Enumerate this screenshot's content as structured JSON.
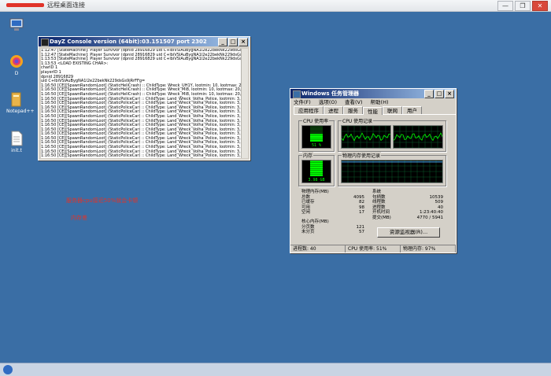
{
  "remote_title": "远程桌面连接",
  "remote_controls": {
    "minimize": "—",
    "restore": "❐",
    "close": "✕"
  },
  "desktop_icons": [
    {
      "label": "",
      "icon": "computer-icon"
    },
    {
      "label": "D",
      "icon": "media-player-icon"
    },
    {
      "label": "Notepad++",
      "icon": "folder-icon"
    },
    {
      "label": "init.t",
      "icon": "text-file-icon"
    }
  ],
  "console": {
    "title": "DayZ Console version (64bit):03.151507   port 2302",
    "lines": [
      "1:12:47 [StateMachine]: Player Survivor (dpnid 28916829 uid C+lbiVSlAuBygNA1l2e22bekNk229dsGs9jRrFFg=",
      "1:12:47 [StateMachine]: Player Survivor (dpnid 28916829 uid C+lbiVSlAuBygNA1l2e22bekNk229dsGs9jRrFFg=",
      "1:13:53 [StateMachine]: Player Survivor (dpnid 28916829 uid C+lbiVSlAuBygNA1l2e22bekNk229dsGs9jRrFFg=",
      "1:13:53 <LOAD EXISTING CHAR>:",
      "   charID 1",
      "   playerID 1",
      "   dpnid 28916829",
      "   uid C+lbiVSlAuBygNA1l2e22bekNk229dsGs9jRrFFg=",
      "1:16:50 [CE][SpawnRandomLoot] (StaticHeliCrash) :: ChildType: Wreck_UH1Y, lootmin: 10, lootmax: 20, wanted",
      "1:16:50 [CE][SpawnRandomLoot] (StaticHeliCrash) :: ChildType: Wreck_Mi8, lootmin: 10, lootmax: 20, wanted",
      "1:16:50 [CE][SpawnRandomLoot] (StaticHeliCrash) :: ChildType: Wreck_Mi8, lootmin: 10, lootmax: 20, wanted",
      "1:16:50 [CE][SpawnRandomLoot] (StaticPoliceCar) :: ChildType: Land_Wreck_Volha_Police, lootmin: 3, lootma",
      "1:16:50 [CE][SpawnRandomLoot] (StaticPoliceCar) :: ChildType: Land_Wreck_Volha_Police, lootmin: 3, lootma",
      "1:16:50 [CE][SpawnRandomLoot] (StaticPoliceCar) :: ChildType: Land_Wreck_Volha_Police, lootmin: 3, lootma",
      "1:16:50 [CE][SpawnRandomLoot] (StaticPoliceCar) :: ChildType: Land_Wreck_Volha_Police, lootmin: 3, lootma",
      "1:16:50 [CE][SpawnRandomLoot] (StaticPoliceCar) :: ChildType: Land_Wreck_Volha_Police, lootmin: 3, lootma",
      "1:16:50 [CE][SpawnRandomLoot] (StaticPoliceCar) :: ChildType: Land_Wreck_Volha_Police, lootmin: 3, lootma",
      "1:16:50 [CE][SpawnRandomLoot] (StaticPoliceCar) :: ChildType: Land_Wreck_Volha_Police, lootmin: 3, lootma",
      "1:16:50 [CE][SpawnRandomLoot] (StaticPoliceCar) :: ChildType: Land_Wreck_Volha_Police, lootmin: 3, lootma",
      "1:16:50 [CE][SpawnRandomLoot] (StaticPoliceCar) :: ChildType: Land_Wreck_Volha_Police, lootmin: 3, lootma",
      "1:16:50 [CE][SpawnRandomLoot] (StaticPoliceCar) :: ChildType: Land_Wreck_Volha_Police, lootmin: 3, lootma",
      "1:16:50 [CE][SpawnRandomLoot] (StaticPoliceCar) :: ChildType: Land_Wreck_Volha_Police, lootmin: 3, lootma",
      "1:16:50 [CE][SpawnRandomLoot] (StaticPoliceCar) :: ChildType: Land_Wreck_Volha_Police, lootmin: 3, lootma",
      "1:16:50 [CE][SpawnRandomLoot] (StaticPoliceCar) :: ChildType: Land_Wreck_Volha_Police, lootmin: 3, lootma",
      "1:16:50 [CE][SpawnRandomLoot] (StaticPoliceCar) :: ChildType: Land_Wreck_Volha_Police, lootmin: 3, lootma"
    ]
  },
  "taskmgr": {
    "title": "Windows 任务管理器",
    "menu": [
      "文件(F)",
      "选项(O)",
      "查看(V)",
      "帮助(H)"
    ],
    "tabs": [
      "应用程序",
      "进程",
      "服务",
      "性能",
      "联网",
      "用户"
    ],
    "active_tab": "性能",
    "cpu_usage_label": "CPU 使用率",
    "cpu_usage_value": "51 %",
    "cpu_usage_fraction": 0.51,
    "cpu_history_label": "CPU 使用记录",
    "mem_label": "内存",
    "mem_value": "3.98 GB",
    "mem_fraction": 0.97,
    "mem_history_label": "物理内存使用记录",
    "physical_mem": {
      "heading": "物理内存(MB)",
      "rows": [
        {
          "k": "总数",
          "v": "4095"
        },
        {
          "k": "已缓存",
          "v": "82"
        },
        {
          "k": "可用",
          "v": "98"
        },
        {
          "k": "空闲",
          "v": "17"
        }
      ]
    },
    "kernel_mem": {
      "heading": "核心内存(MB)",
      "rows": [
        {
          "k": "分页数",
          "v": "121"
        },
        {
          "k": "未分页",
          "v": "57"
        }
      ]
    },
    "system": {
      "heading": "系统",
      "rows": [
        {
          "k": "句柄数",
          "v": "10539"
        },
        {
          "k": "线程数",
          "v": "509"
        },
        {
          "k": "进程数",
          "v": "40"
        },
        {
          "k": "开机时间",
          "v": "1:23:40:40"
        },
        {
          "k": "提交(MB)",
          "v": "4770 / 5941"
        }
      ]
    },
    "resource_monitor_btn": "资源监视器(R)...",
    "status": {
      "processes": "进程数: 40",
      "cpu": "CPU 使用率: 51%",
      "mem": "物理内存: 97%"
    }
  },
  "notes": [
    "服务器cpu接近50%就会卡顿",
    "内存差"
  ],
  "colors": {
    "desktop": "#3a6ea5",
    "graph_green": "#00ff00",
    "note_red": "#e0342a"
  }
}
